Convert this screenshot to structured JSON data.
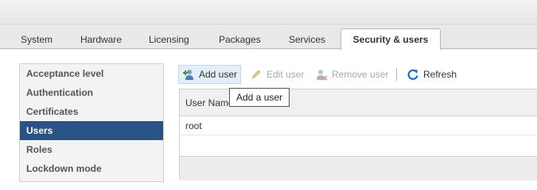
{
  "tabs": [
    {
      "label": "System"
    },
    {
      "label": "Hardware"
    },
    {
      "label": "Licensing"
    },
    {
      "label": "Packages"
    },
    {
      "label": "Services"
    },
    {
      "label": "Security & users"
    }
  ],
  "active_tab_index": 5,
  "sidebar": {
    "items": [
      {
        "label": "Acceptance level"
      },
      {
        "label": "Authentication"
      },
      {
        "label": "Certificates"
      },
      {
        "label": "Users"
      },
      {
        "label": "Roles"
      },
      {
        "label": "Lockdown mode"
      }
    ],
    "selected_index": 3
  },
  "toolbar": {
    "add_label": "Add user",
    "add_icon": "add-user-icon",
    "edit_label": "Edit user",
    "edit_icon": "pencil-icon",
    "remove_label": "Remove user",
    "remove_icon": "remove-user-icon",
    "refresh_label": "Refresh",
    "refresh_icon": "refresh-icon"
  },
  "table": {
    "column_header": "User Name",
    "rows": [
      {
        "name": "root"
      }
    ]
  },
  "tooltip": {
    "text": "Add a user"
  },
  "colors": {
    "selection": "#2a5385",
    "disabled_text": "#a9a9a9",
    "refresh_blue": "#1e6fc4",
    "add_green": "#3a9a3a"
  }
}
